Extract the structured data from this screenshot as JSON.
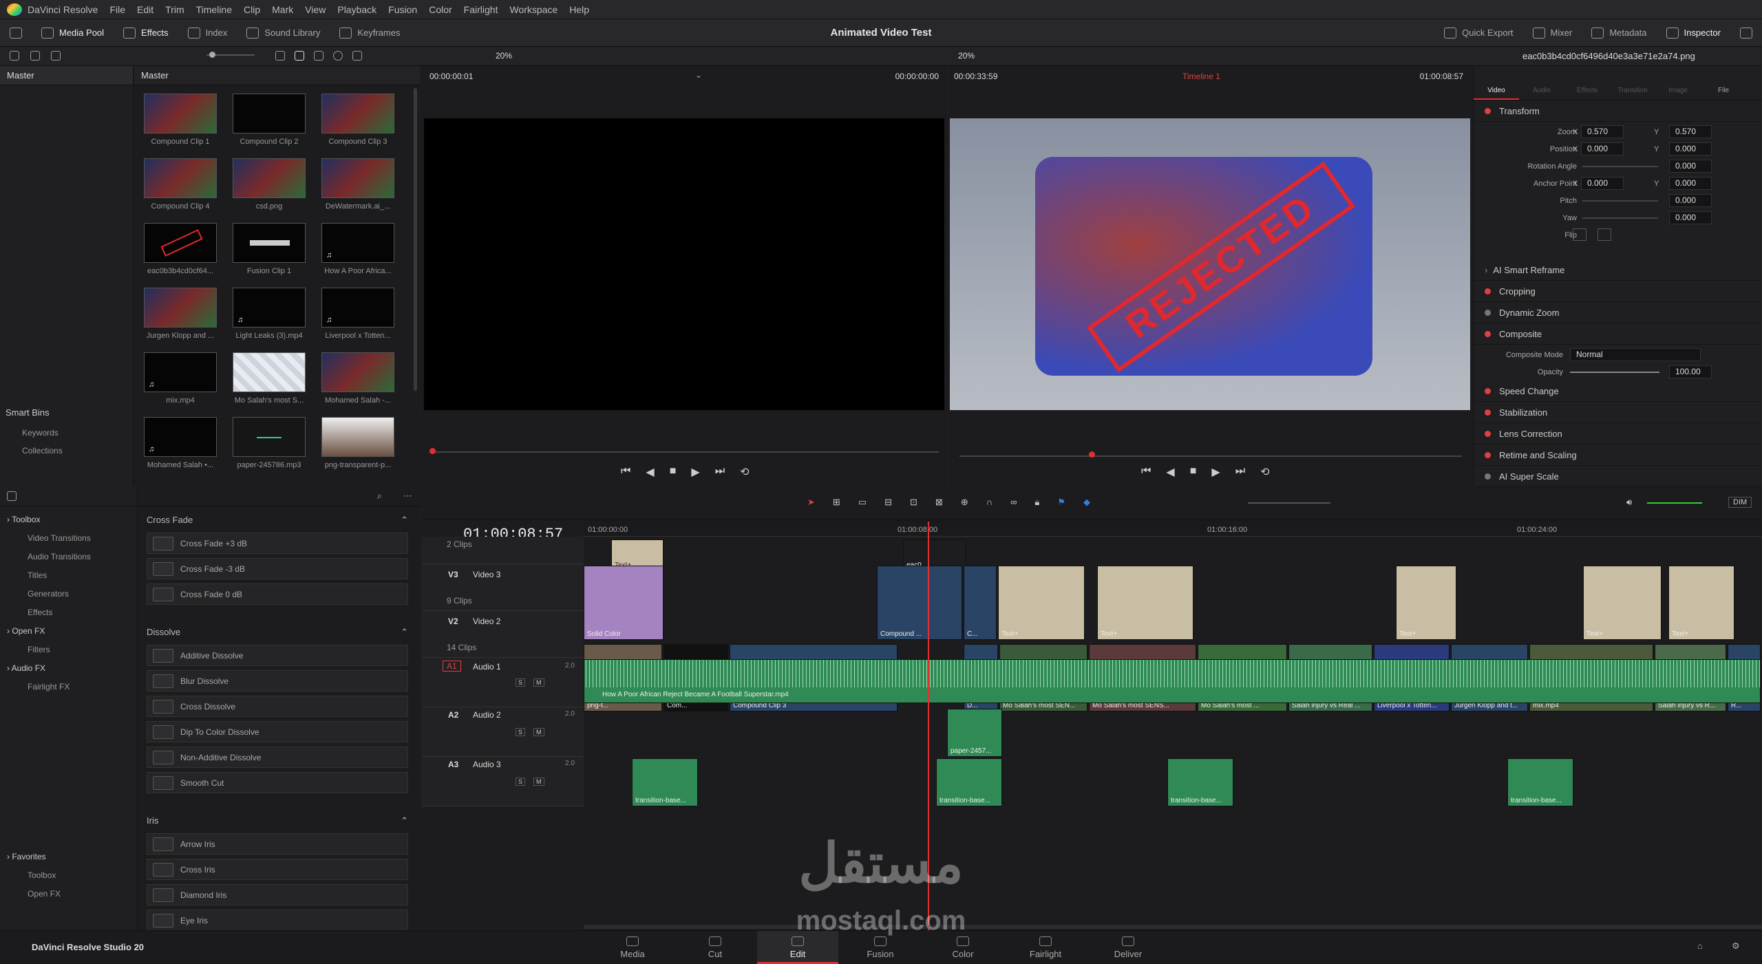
{
  "app": {
    "name": "DaVinci Resolve",
    "studio_label": "DaVinci Resolve Studio 20"
  },
  "menu": [
    "File",
    "Edit",
    "Trim",
    "Timeline",
    "Clip",
    "Mark",
    "View",
    "Playback",
    "Fusion",
    "Color",
    "Fairlight",
    "Workspace",
    "Help"
  ],
  "toolbar": {
    "media_pool": "Media Pool",
    "effects": "Effects",
    "index": "Index",
    "sound_library": "Sound Library",
    "keyframes": "Keyframes",
    "project_title": "Animated Video Test",
    "quick_export": "Quick Export",
    "mixer": "Mixer",
    "metadata": "Metadata",
    "inspector": "Inspector"
  },
  "viewer_bar": {
    "zoom_left": "20%",
    "zoom_right": "20%",
    "clip_name": "eac0b3b4cd0cf6496d40e3a3e71e2a74.png"
  },
  "bins": {
    "title": "Master",
    "smart_bins": "Smart Bins",
    "keywords": "Keywords",
    "collections": "Collections"
  },
  "media_pool": {
    "title": "Master",
    "items": [
      {
        "name": "Compound Clip 1",
        "kind": "video"
      },
      {
        "name": "Compound Clip 2",
        "kind": "dark"
      },
      {
        "name": "Compound Clip 3",
        "kind": "video"
      },
      {
        "name": "Compound Clip 4",
        "kind": "video"
      },
      {
        "name": "csd.png",
        "kind": "video"
      },
      {
        "name": "DeWatermark.ai_...",
        "kind": "video"
      },
      {
        "name": "eac0b3b4cd0cf64...",
        "kind": "rejected"
      },
      {
        "name": "Fusion Clip 1",
        "kind": "fusion"
      },
      {
        "name": "How A Poor Africa...",
        "kind": "audio"
      },
      {
        "name": "Jurgen Klopp and ...",
        "kind": "video"
      },
      {
        "name": "Light Leaks (3).mp4",
        "kind": "audio"
      },
      {
        "name": "Liverpool x Totten...",
        "kind": "audio"
      },
      {
        "name": "mix.mp4",
        "kind": "audio"
      },
      {
        "name": "Mo Salah's most S...",
        "kind": "light"
      },
      {
        "name": "Mohamed Salah -...",
        "kind": "video"
      },
      {
        "name": "Mohamed Salah •...",
        "kind": "audio"
      },
      {
        "name": "paper-245786.mp3",
        "kind": "paper"
      },
      {
        "name": "png-transparent-p...",
        "kind": "portrait"
      }
    ]
  },
  "source_viewer": {
    "timecode_left": "00:00:00:01",
    "timecode_right": "00:00:00:00"
  },
  "timeline_viewer": {
    "timecode_left": "00:00:33:59",
    "timeline_name": "Timeline 1",
    "timecode_right": "01:00:08:57",
    "overlay_text": "REJECTED"
  },
  "inspector": {
    "tabs": [
      "Video",
      "Audio",
      "Effects",
      "Transition",
      "Image",
      "File"
    ],
    "sections": {
      "transform": "Transform",
      "ai_smart_reframe": "AI Smart Reframe",
      "cropping": "Cropping",
      "dynamic_zoom": "Dynamic Zoom",
      "composite": "Composite",
      "speed_change": "Speed Change",
      "stabilization": "Stabilization",
      "lens_correction": "Lens Correction",
      "retime_scaling": "Retime and Scaling",
      "ai_super_scale": "AI Super Scale"
    },
    "params": {
      "zoom": "Zoom",
      "zoom_x": "0.570",
      "zoom_y": "0.570",
      "position": "Position",
      "pos_x": "0.000",
      "pos_y": "0.000",
      "rotation": "Rotation Angle",
      "rotation_val": "0.000",
      "anchor": "Anchor Point",
      "anchor_x": "0.000",
      "anchor_y": "0.000",
      "pitch": "Pitch",
      "pitch_val": "0.000",
      "yaw": "Yaw",
      "yaw_val": "0.000",
      "flip": "Flip",
      "x": "X",
      "y": "Y",
      "composite_mode": "Composite Mode",
      "composite_mode_val": "Normal",
      "opacity": "Opacity",
      "opacity_val": "100.00"
    }
  },
  "effects_panel": {
    "tree": [
      {
        "label": "Toolbox",
        "level": 0
      },
      {
        "label": "Video Transitions",
        "level": 1
      },
      {
        "label": "Audio Transitions",
        "level": 1
      },
      {
        "label": "Titles",
        "level": 1
      },
      {
        "label": "Generators",
        "level": 1
      },
      {
        "label": "Effects",
        "level": 1
      },
      {
        "label": "Open FX",
        "level": 0
      },
      {
        "label": "Filters",
        "level": 1
      },
      {
        "label": "Audio FX",
        "level": 0
      },
      {
        "label": "Fairlight FX",
        "level": 1
      }
    ],
    "favorites": [
      {
        "label": "Favorites",
        "level": 0
      },
      {
        "label": "Toolbox",
        "level": 1
      },
      {
        "label": "Open FX",
        "level": 1
      }
    ],
    "groups": [
      {
        "title": "Cross Fade",
        "items": [
          "Cross Fade +3 dB",
          "Cross Fade -3 dB",
          "Cross Fade 0 dB"
        ]
      },
      {
        "title": "Dissolve",
        "items": [
          "Additive Dissolve",
          "Blur Dissolve",
          "Cross Dissolve",
          "Dip To Color Dissolve",
          "Non-Additive Dissolve",
          "Smooth Cut"
        ]
      },
      {
        "title": "Iris",
        "items": [
          "Arrow Iris",
          "Cross Iris",
          "Diamond Iris",
          "Eye Iris"
        ]
      }
    ]
  },
  "timeline": {
    "timecode": "01:00:08:57",
    "ruler": [
      "01:00:00:00",
      "01:00:08:00",
      "01:00:16:00",
      "01:00:24:00"
    ],
    "tracks": {
      "v4_clips": "2 Clips",
      "v3": "V3",
      "v3_name": "Video 3",
      "v3_clips": "9 Clips",
      "v2": "V2",
      "v2_name": "Video 2",
      "v2_clips": "14 Clips",
      "a1": "A1",
      "a1_name": "Audio 1",
      "a2": "A2",
      "a2_name": "Audio 2",
      "a3": "A3",
      "a3_name": "Audio 3",
      "ch": "2.0",
      "s": "S",
      "m": "M"
    },
    "clips": {
      "text": "Text+",
      "solid": "Solid Color",
      "eac": "eac0...",
      "compound": "Compound ...",
      "c": "C...",
      "png": "png-t...",
      "com": "Com...",
      "cc3": "Compound Clip 3",
      "d": "D...",
      "mo1": "Mo Salah's most SEN...",
      "mo2": "Mo Salah's most SENS...",
      "mo3": "Mo Salah's most ...",
      "injury": "Salah injury vs Real ...",
      "liv": "Liverpool x Totten...",
      "klopp": "Jurgen Klopp and t...",
      "mix": "mix.mp4",
      "injury2": "Salah injury vs R...",
      "r": "R...",
      "audio1": "How A Poor African Reject Became A Football Superstar.mp4",
      "paper": "paper-2457...",
      "trans": "transition-base..."
    }
  },
  "pages": [
    "Media",
    "Cut",
    "Edit",
    "Fusion",
    "Color",
    "Fairlight",
    "Deliver"
  ],
  "watermark": {
    "arabic": "مستقل",
    "latin": "mostaql.com"
  },
  "misc": {
    "dim": "DIM"
  }
}
